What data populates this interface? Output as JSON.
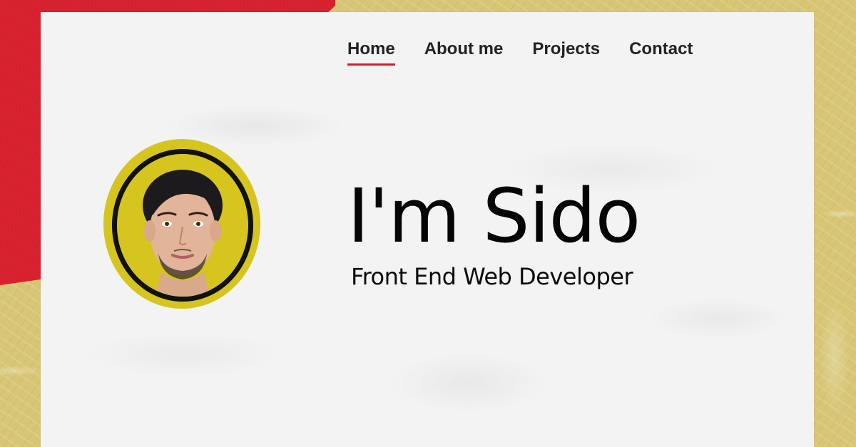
{
  "nav": {
    "items": [
      {
        "label": "Home",
        "active": true
      },
      {
        "label": "About me",
        "active": false
      },
      {
        "label": "Projects",
        "active": false
      },
      {
        "label": "Contact",
        "active": false
      }
    ]
  },
  "hero": {
    "name": "I'm Sido",
    "role": "Front End Web Developer"
  },
  "colors": {
    "accent_red": "#d9222f",
    "gold": "#d8c676",
    "avatar_ring_yellow": "#d6c41f",
    "paper": "#f3f3f3",
    "active_underline": "#c8222c"
  }
}
